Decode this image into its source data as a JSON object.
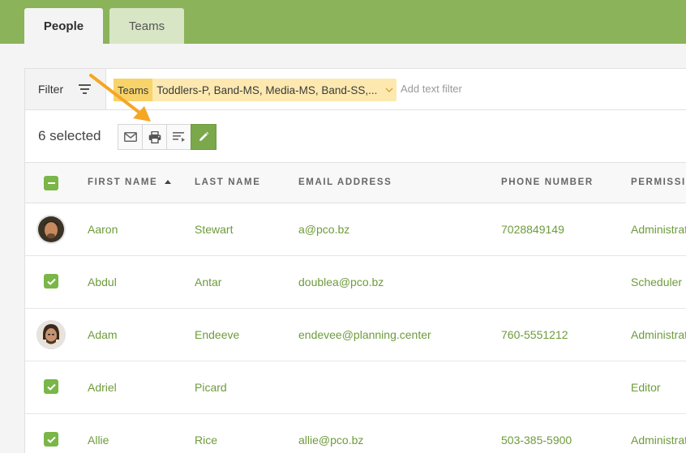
{
  "tabs": [
    {
      "label": "People",
      "active": true
    },
    {
      "label": "Teams",
      "active": false
    }
  ],
  "filter": {
    "button_label": "Filter",
    "chip_label": "Teams",
    "chip_value": "Toddlers-P, Band-MS, Media-MS, Band-SS,...",
    "text_filter_placeholder": "Add text filter"
  },
  "selection": {
    "count_text": "6 selected",
    "actions": [
      "mail-icon",
      "print-icon",
      "sort-list-icon",
      "pencil-icon"
    ]
  },
  "table": {
    "columns": [
      "FIRST NAME",
      "LAST NAME",
      "EMAIL ADDRESS",
      "PHONE NUMBER",
      "PERMISSIONS"
    ],
    "sort": {
      "column": "FIRST NAME",
      "direction": "ascending"
    },
    "rows": [
      {
        "first": "Aaron",
        "last": "Stewart",
        "email": "a@pco.bz",
        "phone": "7028849149",
        "permission": "Administrator",
        "selected": false,
        "has_avatar": true
      },
      {
        "first": "Abdul",
        "last": "Antar",
        "email": "doublea@pco.bz",
        "phone": "",
        "permission": "Scheduler",
        "selected": true,
        "has_avatar": false
      },
      {
        "first": "Adam",
        "last": "Endeeve",
        "email": "endevee@planning.center",
        "phone": "760-5551212",
        "permission": "Administrator",
        "selected": false,
        "has_avatar": true
      },
      {
        "first": "Adriel",
        "last": "Picard",
        "email": "",
        "phone": "",
        "permission": "Editor",
        "selected": true,
        "has_avatar": false
      },
      {
        "first": "Allie",
        "last": "Rice",
        "email": "allie@pco.bz",
        "phone": "503-385-5900",
        "permission": "Administrator",
        "selected": true,
        "has_avatar": false
      }
    ]
  },
  "colors": {
    "brand_green": "#8bb35a",
    "link_green": "#6e9b3c",
    "chip_yellow": "#fde9b0",
    "annotation_arrow": "#f5a623"
  }
}
